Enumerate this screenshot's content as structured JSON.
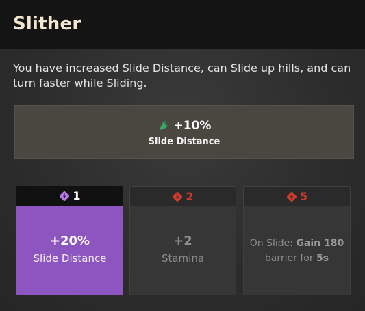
{
  "title": "Slither",
  "description": "You have increased Slide Distance, can Slide up hills, and can turn faster while Sliding.",
  "bonus": {
    "icon": "slide-boot-icon",
    "value": "+10%",
    "label": "Slide Distance"
  },
  "tiers": [
    {
      "icon": "augment-point-icon",
      "cost": "1",
      "main": "+20%",
      "sub": "Slide Distance",
      "active": true,
      "color": "#8d55bf"
    },
    {
      "icon": "augment-point-icon",
      "cost": "2",
      "main": "+2",
      "sub": "Stamina",
      "active": false,
      "color": "#cf3b2a"
    },
    {
      "icon": "augment-point-icon",
      "cost": "5",
      "prefix": "On Slide: ",
      "bold1": "Gain 180",
      "line2": "barrier for ",
      "bold2": "5s",
      "active": false,
      "color": "#cf3b2a"
    }
  ],
  "colors": {
    "accent_purple": "#8d55bf",
    "locked_red": "#cf3b2a",
    "bonus_green": "#3aa56b",
    "title_cream": "#f3e7cf"
  }
}
